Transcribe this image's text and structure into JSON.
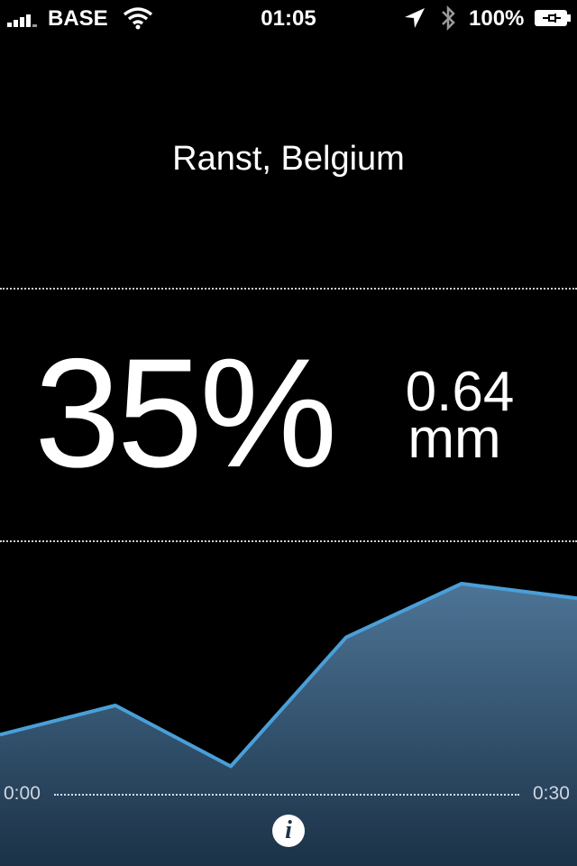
{
  "status_bar": {
    "carrier": "BASE",
    "time": "01:05",
    "battery": "100%",
    "icons": [
      "signal-icon",
      "wifi-icon",
      "location-arrow-icon",
      "bluetooth-icon",
      "battery-charging-icon"
    ]
  },
  "location": "Ranst, Belgium",
  "humidity": "35%",
  "precipitation": {
    "value": "0.64",
    "unit": "mm"
  },
  "chart_data": {
    "type": "area",
    "x_start_label": "0:00",
    "x_end_label": "0:30",
    "series": [
      {
        "values": [
          0.28,
          0.4,
          0.15,
          0.68,
          0.9,
          0.84
        ]
      }
    ],
    "ylim": [
      0,
      1
    ],
    "colors": {
      "line": "#4a9fd8",
      "fill_top": "#4d7496",
      "fill_bottom": "#1b3247"
    }
  },
  "info_button": {
    "label": "i"
  }
}
